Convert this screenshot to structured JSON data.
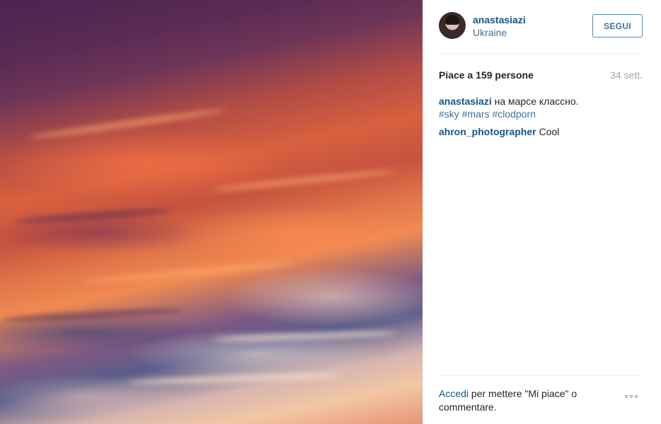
{
  "post": {
    "username": "anastasiazi",
    "location": "Ukraine",
    "follow_label": "SEGUI",
    "likes_text": "Piace a 159 persone",
    "time_ago": "34 sett."
  },
  "comments": [
    {
      "user": "anastasiazi",
      "text": "на марсе классно.",
      "tags": [
        "#sky",
        "#mars",
        "#clodporn"
      ]
    },
    {
      "user": "ahron_photographer",
      "text": "Cool"
    }
  ],
  "footer": {
    "login_link": "Accedi",
    "login_text": " per mettere \"Mi piace\" o commentare.",
    "more_icon": "more-options-icon"
  }
}
